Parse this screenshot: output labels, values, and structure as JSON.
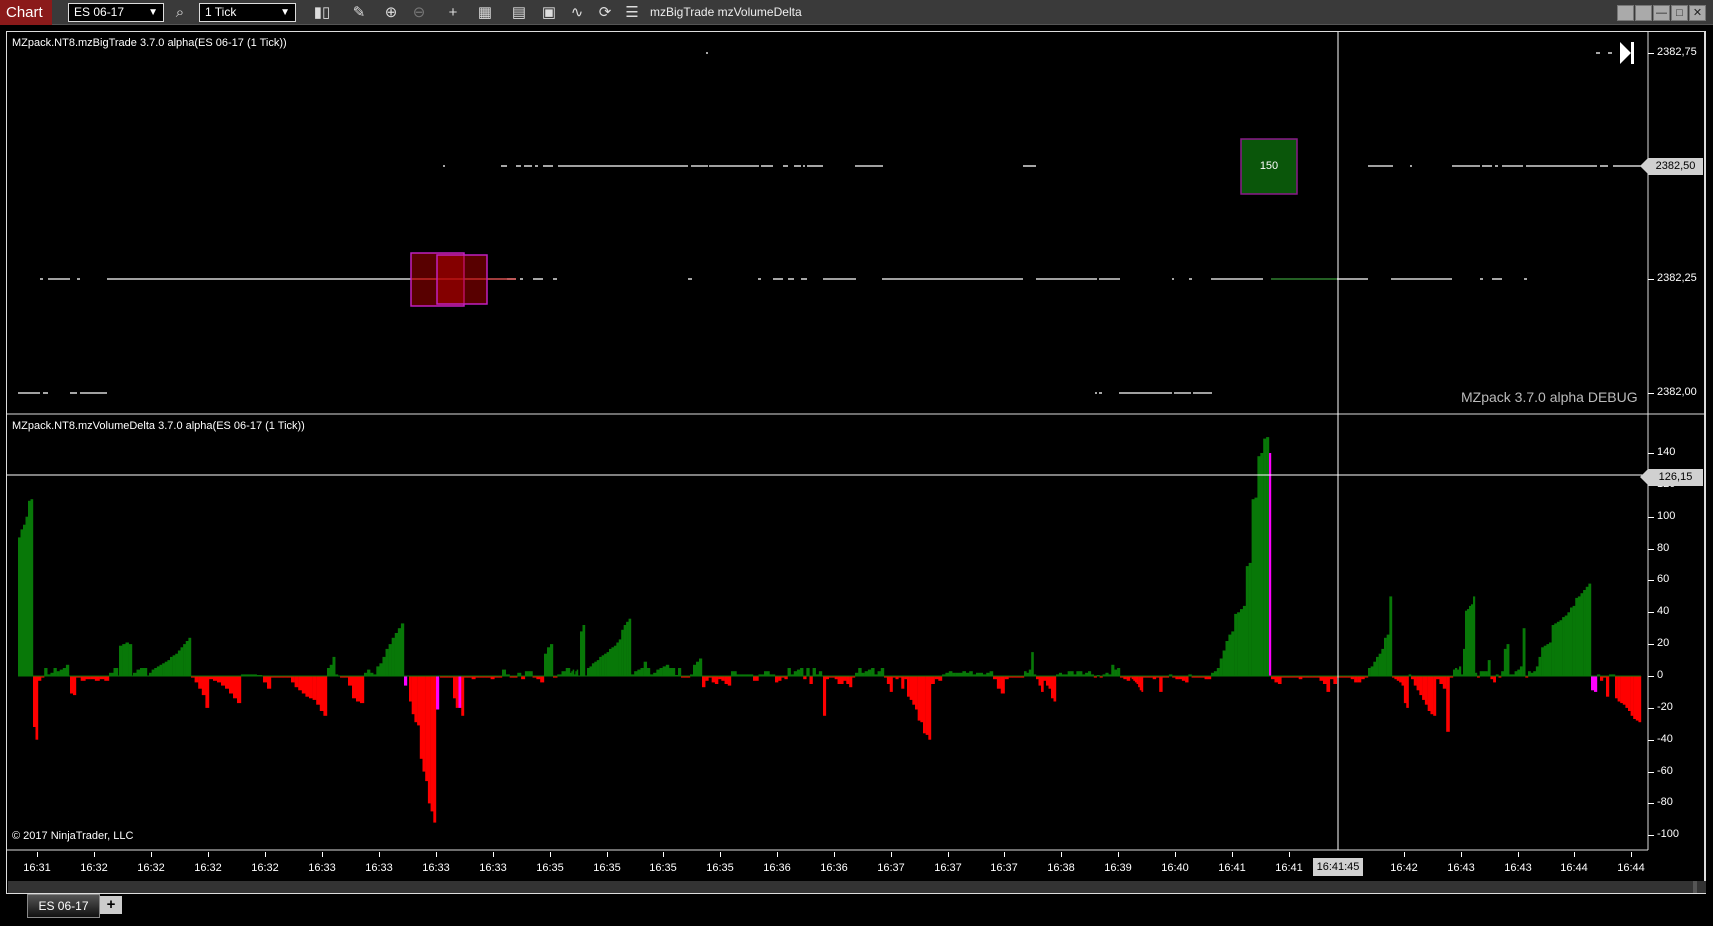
{
  "toolbar": {
    "chart_label": "Chart",
    "instrument": "ES 06-17",
    "interval": "1 Tick",
    "indicators": "mzBigTrade  mzVolumeDelta",
    "icons": [
      "search-icon",
      "bar-style-icon",
      "pencil-icon",
      "zoom-in-icon",
      "zoom-out-icon",
      "crosshair-icon",
      "data-box-icon",
      "chart-trader-icon",
      "properties-icon",
      "strategy-icon",
      "reload-icon",
      "list-icon"
    ]
  },
  "upper_panel": {
    "title": "MZpack.NT8.mzBigTrade 3.7.0 alpha(ES 06-17 (1 Tick))",
    "watermark": "MZpack 3.7.0 alpha DEBUG",
    "price_levels": [
      2382.75,
      2382.5,
      2382.25,
      2382.0
    ],
    "axis_labels": [
      "2382,75",
      "2382,50",
      "2382,25",
      "2382,00"
    ],
    "last_price_marker": "2382,50",
    "big_trade_label": "150",
    "colors": {
      "buy_box": "#0a560a",
      "sell_box": "#b00000",
      "box_border": "#c020c0"
    }
  },
  "lower_panel": {
    "title": "MZpack.NT8.mzVolumeDelta 3.7.0 alpha(ES 06-17 (1 Tick))",
    "copyright": "© 2017 NinjaTrader, LLC",
    "crosshair_value": "126,15",
    "axis_labels": [
      "140",
      "120",
      "100",
      "80",
      "60",
      "40",
      "20",
      "0",
      "-20",
      "-40",
      "-60",
      "-80",
      "-100"
    ]
  },
  "chart_data": {
    "type": "bar",
    "ylim": [
      -105,
      150
    ],
    "yticks": [
      140,
      120,
      100,
      80,
      60,
      40,
      20,
      0,
      -20,
      -40,
      -60,
      -80,
      -100
    ],
    "colors": {
      "positive": "#087808",
      "negative": "#ff0000",
      "highlight": "#ff00ff"
    },
    "crosshair": {
      "value": 126.15,
      "time": "16:41:45"
    },
    "series_groups": [
      [
        87,
        92,
        95,
        100,
        110,
        111
      ],
      [
        -32,
        -40
      ],
      [
        -3,
        -1,
        5,
        1,
        2,
        5,
        3,
        4,
        5,
        7
      ],
      [
        -11,
        -12
      ],
      [
        -1,
        -3,
        -2,
        -2,
        -3,
        -2,
        -3
      ],
      [
        2,
        5
      ],
      [
        19,
        20,
        21,
        20
      ],
      [
        2,
        4,
        5,
        5
      ],
      [
        2,
        4,
        5,
        6,
        7,
        8,
        9,
        10,
        12,
        13,
        14,
        16,
        18,
        20,
        22,
        24
      ],
      [
        -1,
        -4,
        -8,
        -12,
        -20
      ],
      [
        -2,
        -3,
        -4,
        -6,
        -8,
        -11,
        -14,
        -17
      ],
      [
        1,
        1,
        1,
        0
      ],
      [
        -4,
        -8
      ],
      [
        -1,
        -1,
        -1,
        -1,
        -1
      ],
      [
        -4,
        -7,
        -9,
        -11,
        -13,
        -14,
        -15,
        -18,
        -22,
        -25
      ],
      [
        5,
        7,
        12,
        1
      ],
      [
        -1,
        -1,
        -6,
        -14,
        -16,
        -17
      ],
      [
        2,
        4,
        2,
        1,
        6,
        8,
        12,
        17,
        20,
        24,
        27,
        30,
        33
      ],
      [
        {
          "value": -6,
          "highlight": true
        }
      ],
      [
        -16,
        -24,
        -29,
        -31,
        -52,
        -60,
        -66,
        -80,
        -85,
        -92
      ],
      [
        {
          "value": -21,
          "highlight": true
        }
      ],
      [
        -1,
        -1,
        -1
      ],
      [
        -14,
        -20,
        {
          "value": -20,
          "highlight": true
        },
        -25
      ],
      [
        -1,
        -1,
        -2,
        -1,
        -1,
        -1,
        -1,
        -2,
        -1,
        -1
      ],
      [
        4,
        1,
        -1,
        -1,
        2,
        -2,
        3,
        3,
        -1,
        -2,
        -4
      ],
      [
        14,
        18,
        20
      ],
      [
        -1,
        1,
        3,
        5
      ],
      [
        2,
        3,
        4,
        1,
        3,
        4
      ],
      [
        28,
        32
      ],
      [
        5,
        6,
        8,
        9,
        10,
        12,
        13,
        14,
        15,
        17,
        18,
        19,
        21,
        23,
        29,
        32,
        34,
        36
      ],
      [
        1,
        3,
        4,
        5,
        9,
        5,
        1,
        2,
        4,
        5,
        6,
        7
      ],
      [
        5,
        5,
        0,
        5,
        -1,
        -1,
        -1,
        1,
        7,
        9,
        11
      ],
      [
        -7,
        -3,
        -1,
        -4,
        -5,
        -2,
        -3,
        -5,
        -6
      ],
      [
        3,
        1,
        1,
        1,
        -3,
        1,
        3,
        1
      ],
      [
        -4,
        -3,
        -1,
        -2,
        5,
        1,
        3,
        4,
        5,
        -2,
        5,
        -5,
        5,
        1,
        3
      ],
      [
        -25,
        -2,
        -1,
        -1,
        -2,
        -5,
        -5,
        -3,
        -5,
        -7,
        -1
      ],
      [
        2,
        5,
        2,
        3,
        4,
        5,
        1,
        3,
        5
      ],
      [
        -1,
        -5,
        -10,
        -1,
        -2,
        -1,
        -8,
        -2
      ],
      [
        -13,
        -15,
        -18,
        -21,
        -28,
        -29,
        -36,
        -37,
        -40
      ],
      [
        -5,
        -2,
        -3
      ],
      [
        1,
        2,
        3,
        2,
        2,
        2,
        3,
        2,
        3,
        1,
        2,
        2,
        1,
        2,
        3
      ],
      [
        -2,
        -8,
        -11,
        -2,
        -1,
        -1,
        -1,
        -1
      ],
      [
        3,
        2,
        4,
        15,
        1
      ],
      [
        -2,
        -6,
        -10,
        -3,
        -6,
        -8,
        -14,
        -16
      ],
      [
        1,
        2,
        1,
        1,
        3,
        3,
        1,
        3,
        3,
        1,
        2,
        3,
        1,
        -1,
        0,
        -1,
        1,
        2,
        1,
        7,
        4,
        5
      ],
      [
        -1,
        -2,
        -3
      ],
      [
        -1,
        -2,
        -3,
        -4,
        -5,
        -7,
        -9,
        -10
      ],
      [
        -1,
        -1,
        -1,
        -2,
        -1,
        -10,
        -1,
        -1,
        1,
        -1,
        -2,
        -2,
        -3,
        -4,
        1,
        -1,
        -1,
        -1,
        -1,
        -2,
        -2
      ],
      [
        2,
        3,
        5,
        11,
        16,
        22,
        26,
        28,
        39,
        40,
        42,
        44,
        69,
        71,
        111,
        112,
        138,
        140,
        149,
        150
      ],
      [
        {
          "value": 140,
          "highlight": true
        }
      ],
      [
        -2,
        -4,
        -5,
        -1,
        -1,
        -1,
        -1,
        -1,
        -2,
        -1,
        -1,
        -1,
        -1,
        -1,
        -3,
        -5,
        -10,
        -2,
        -5,
        -1,
        -1,
        -1,
        -1,
        -2,
        -4,
        -4,
        -2,
        -1
      ],
      [
        5,
        6,
        9,
        12,
        14,
        17,
        24,
        26,
        50
      ],
      [
        -1,
        -2,
        -3,
        -4,
        -6,
        -17,
        -20,
        1
      ],
      [
        -2,
        -6,
        -9,
        -12,
        -15,
        -18,
        -22,
        -24,
        -25
      ],
      [
        -2,
        -5,
        -8,
        -35,
        -1
      ],
      [
        4,
        5,
        4,
        6,
        1,
        17,
        41,
        42,
        44,
        45,
        50,
        2
      ],
      [
        -1,
        3,
        3,
        3,
        10,
        -2,
        -4,
        1,
        -1,
        3,
        17,
        20,
        1,
        1,
        3,
        4,
        6,
        30,
        -1
      ],
      [
        3,
        2,
        3,
        6,
        12,
        18,
        19,
        20,
        21,
        32,
        33,
        34,
        35,
        37,
        38,
        40,
        43,
        44,
        49,
        50,
        52,
        54,
        56,
        58
      ],
      [
        {
          "value": -9,
          "highlight": true
        },
        {
          "value": -10,
          "highlight": true
        }
      ],
      [
        1,
        -3,
        -1,
        -13,
        1,
        1
      ],
      [
        -14,
        -16,
        -17,
        -18,
        -20,
        -22,
        -25,
        -27,
        -28,
        -29
      ]
    ]
  },
  "time_axis": {
    "labels": [
      "16:31",
      "16:32",
      "16:32",
      "16:32",
      "16:32",
      "16:33",
      "16:33",
      "16:33",
      "16:33",
      "16:35",
      "16:35",
      "16:35",
      "16:35",
      "16:36",
      "16:36",
      "16:37",
      "16:37",
      "16:37",
      "16:38",
      "16:39",
      "16:40",
      "16:41",
      "16:41",
      "16:42",
      "16:43",
      "16:43",
      "16:44",
      "16:44"
    ],
    "crosshair_time": "16:41:45"
  },
  "tabs": [
    {
      "label": "ES 06-17"
    }
  ],
  "add_tab_label": "+"
}
